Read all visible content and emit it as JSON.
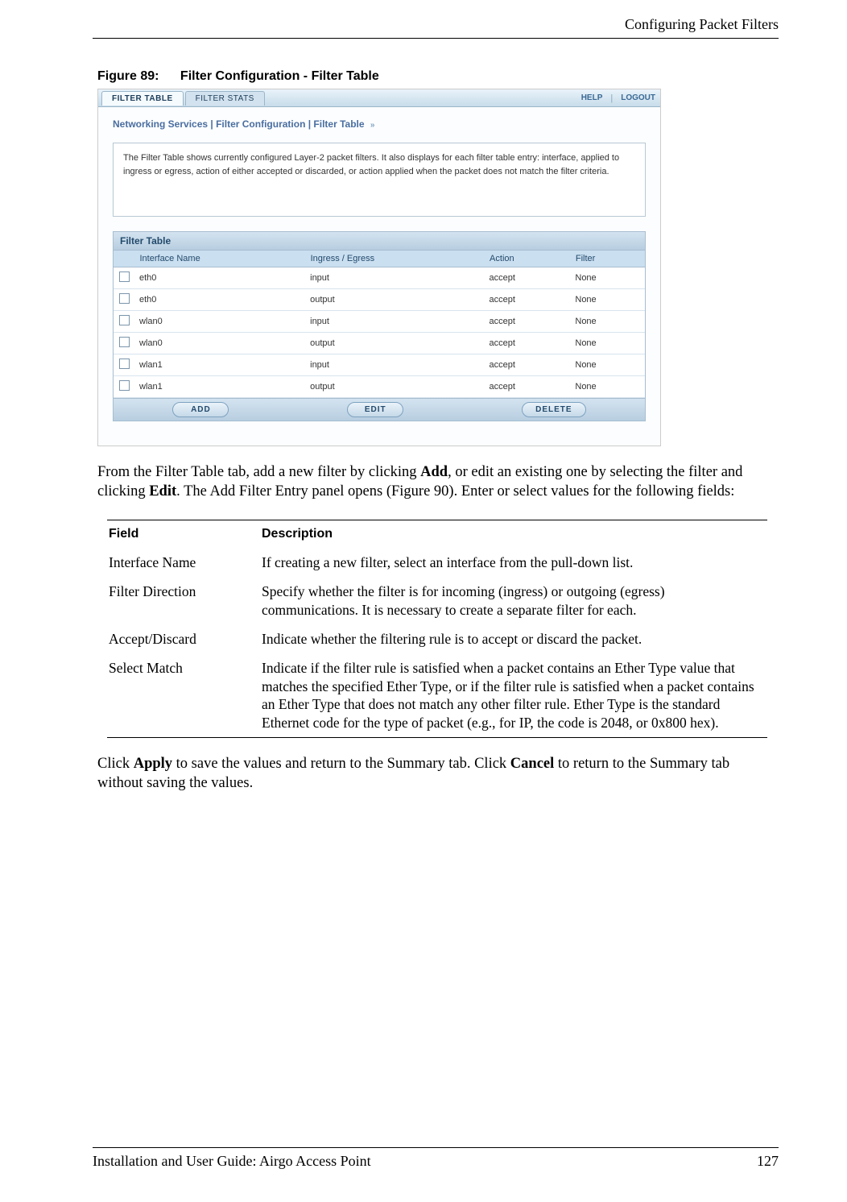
{
  "header": {
    "section_title": "Configuring Packet Filters"
  },
  "figure": {
    "number": "Figure 89:",
    "title": "Filter Configuration - Filter Table"
  },
  "shot": {
    "tabs": {
      "active": "FILTER TABLE",
      "other": "FILTER STATS"
    },
    "toplinks": {
      "help": "HELP",
      "logout": "LOGOUT"
    },
    "breadcrumb": "Networking Services | Filter Configuration | Filter Table",
    "description": "The Filter Table shows currently configured Layer-2 packet filters. It also displays for each filter table entry: interface, applied to ingress or egress, action of either accepted or discarded, or action applied when the packet does not match the filter criteria.",
    "panel_title": "Filter Table",
    "columns": {
      "c1": "Interface Name",
      "c2": "Ingress / Egress",
      "c3": "Action",
      "c4": "Filter"
    },
    "rows": [
      {
        "iface": "eth0",
        "dir": "input",
        "act": "accept",
        "flt": "None"
      },
      {
        "iface": "eth0",
        "dir": "output",
        "act": "accept",
        "flt": "None"
      },
      {
        "iface": "wlan0",
        "dir": "input",
        "act": "accept",
        "flt": "None"
      },
      {
        "iface": "wlan0",
        "dir": "output",
        "act": "accept",
        "flt": "None"
      },
      {
        "iface": "wlan1",
        "dir": "input",
        "act": "accept",
        "flt": "None"
      },
      {
        "iface": "wlan1",
        "dir": "output",
        "act": "accept",
        "flt": "None"
      }
    ],
    "buttons": {
      "add": "ADD",
      "edit": "EDIT",
      "delete": "DELETE"
    }
  },
  "para1_pre": "From the Filter Table tab, add a new filter by clicking ",
  "para1_b1": "Add",
  "para1_mid": ", or edit an existing one by selecting the filter and clicking ",
  "para1_b2": "Edit",
  "para1_post": ". The Add Filter Entry panel opens (Figure 90). Enter or select values for the following fields:",
  "fieldTable": {
    "head_field": "Field",
    "head_desc": "Description",
    "rows": [
      {
        "f": "Interface Name",
        "d": "If creating a new filter, select an interface from the pull-down list."
      },
      {
        "f": "Filter Direction",
        "d": "Specify whether the filter is for incoming (ingress) or outgoing (egress) communications. It is necessary to create a separate filter for each."
      },
      {
        "f": "Accept/Discard",
        "d": "Indicate whether the filtering rule is to accept or discard the packet."
      },
      {
        "f": "Select Match",
        "d": "Indicate if the filter rule is satisfied when a packet contains an Ether Type value that matches the specified Ether Type, or if the filter rule is satisfied when a packet contains an Ether Type that does not match any other filter rule. Ether Type is the standard Ethernet code for the type of packet (e.g., for IP, the code is 2048, or 0x800 hex)."
      }
    ]
  },
  "para2_pre": "Click ",
  "para2_b1": "Apply",
  "para2_mid": " to save the values and return to the Summary tab. Click ",
  "para2_b2": "Cancel",
  "para2_post": " to return to the Summary tab without saving the values.",
  "footer": {
    "left": "Installation and User Guide: Airgo Access Point",
    "right": "127"
  }
}
